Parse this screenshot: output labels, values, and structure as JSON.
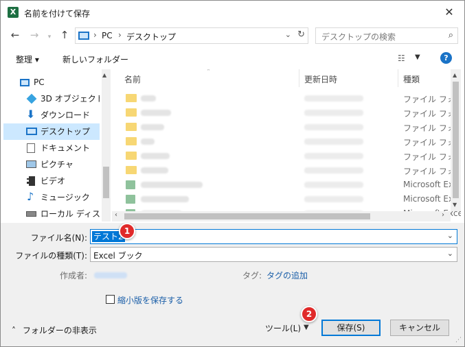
{
  "window": {
    "title": "名前を付けて保存",
    "app_icon_letter": "X"
  },
  "nav": {
    "breadcrumbs": [
      "PC",
      "デスクトップ"
    ],
    "search_placeholder": "デスクトップの検索"
  },
  "toolbar": {
    "organize": "整理 ▾",
    "new_folder": "新しいフォルダー",
    "help": "?"
  },
  "sidebar": {
    "items": [
      {
        "label": "PC",
        "icon": "pc-icon"
      },
      {
        "label": "3D オブジェクト",
        "icon": "cube-icon"
      },
      {
        "label": "ダウンロード",
        "icon": "download-icon"
      },
      {
        "label": "デスクトップ",
        "icon": "desktop-icon",
        "selected": true
      },
      {
        "label": "ドキュメント",
        "icon": "document-icon"
      },
      {
        "label": "ピクチャ",
        "icon": "picture-icon"
      },
      {
        "label": "ビデオ",
        "icon": "video-icon"
      },
      {
        "label": "ミュージック",
        "icon": "music-icon"
      },
      {
        "label": "ローカル ディスク (C",
        "icon": "disk-icon"
      }
    ]
  },
  "file_list": {
    "columns": [
      "名前",
      "更新日時",
      "種類"
    ],
    "rows": [
      {
        "kind": "folder",
        "type": "ファイル フォルダー"
      },
      {
        "kind": "folder",
        "type": "ファイル フォルダー"
      },
      {
        "kind": "folder",
        "type": "ファイル フォルダー"
      },
      {
        "kind": "folder",
        "type": "ファイル フォルダー"
      },
      {
        "kind": "folder",
        "type": "ファイル フォルダー"
      },
      {
        "kind": "folder",
        "type": "ファイル フォルダー"
      },
      {
        "kind": "excel",
        "type": "Microsoft Excel"
      },
      {
        "kind": "excel",
        "type": "Microsoft Excel"
      },
      {
        "kind": "excel",
        "type": "Microsoft Excel"
      }
    ]
  },
  "form": {
    "filename_label": "ファイル名(N):",
    "filename_value": "テスト2",
    "filetype_label": "ファイルの種類(T):",
    "filetype_value": "Excel ブック",
    "author_label": "作成者:",
    "tag_label": "タグ:",
    "tag_link": "タグの追加",
    "thumbnail_label": "縮小版を保存する",
    "hide_folders": "フォルダーの非表示",
    "tools": "ツール(L)",
    "save": "保存(S)",
    "cancel": "キャンセル"
  },
  "callouts": [
    "1",
    "2"
  ],
  "colors": {
    "accent": "#0078d7",
    "selected_bg": "#cce8ff",
    "badge": "#e02a2a",
    "excel": "#1d6f42"
  }
}
